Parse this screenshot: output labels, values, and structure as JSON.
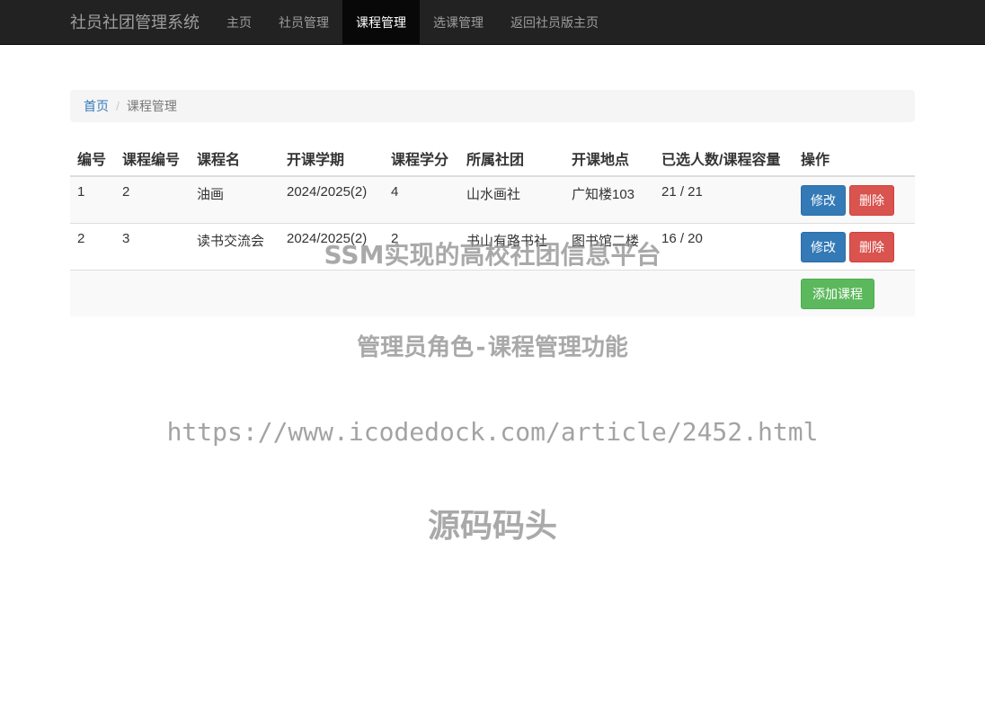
{
  "navbar": {
    "brand": "社员社团管理系统",
    "items": [
      {
        "label": "主页",
        "active": false
      },
      {
        "label": "社员管理",
        "active": false
      },
      {
        "label": "课程管理",
        "active": true
      },
      {
        "label": "选课管理",
        "active": false
      },
      {
        "label": "返回社员版主页",
        "active": false
      }
    ]
  },
  "breadcrumb": {
    "home": "首页",
    "separator": "/",
    "current": "课程管理"
  },
  "table": {
    "headers": [
      "编号",
      "课程编号",
      "课程名",
      "开课学期",
      "课程学分",
      "所属社团",
      "开课地点",
      "已选人数/课程容量",
      "操作"
    ],
    "rows": [
      [
        "1",
        "2",
        "油画",
        "2024/2025(2)",
        "4",
        "山水画社",
        "广知楼103",
        "21 / 21"
      ],
      [
        "2",
        "3",
        "读书交流会",
        "2024/2025(2)",
        "2",
        "书山有路书社",
        "图书馆二楼",
        "16 / 20"
      ]
    ],
    "edit_label": "修改",
    "delete_label": "删除",
    "add_label": "添加课程"
  },
  "watermark": {
    "line1": "SSM实现的高校社团信息平台",
    "line2": "管理员角色-课程管理功能",
    "line3": "https://www.icodedock.com/article/2452.html",
    "line4": "源码码头"
  },
  "colors": {
    "navbar_bg": "#222222",
    "primary": "#337ab7",
    "danger": "#d9534f",
    "success": "#5cb85c"
  }
}
